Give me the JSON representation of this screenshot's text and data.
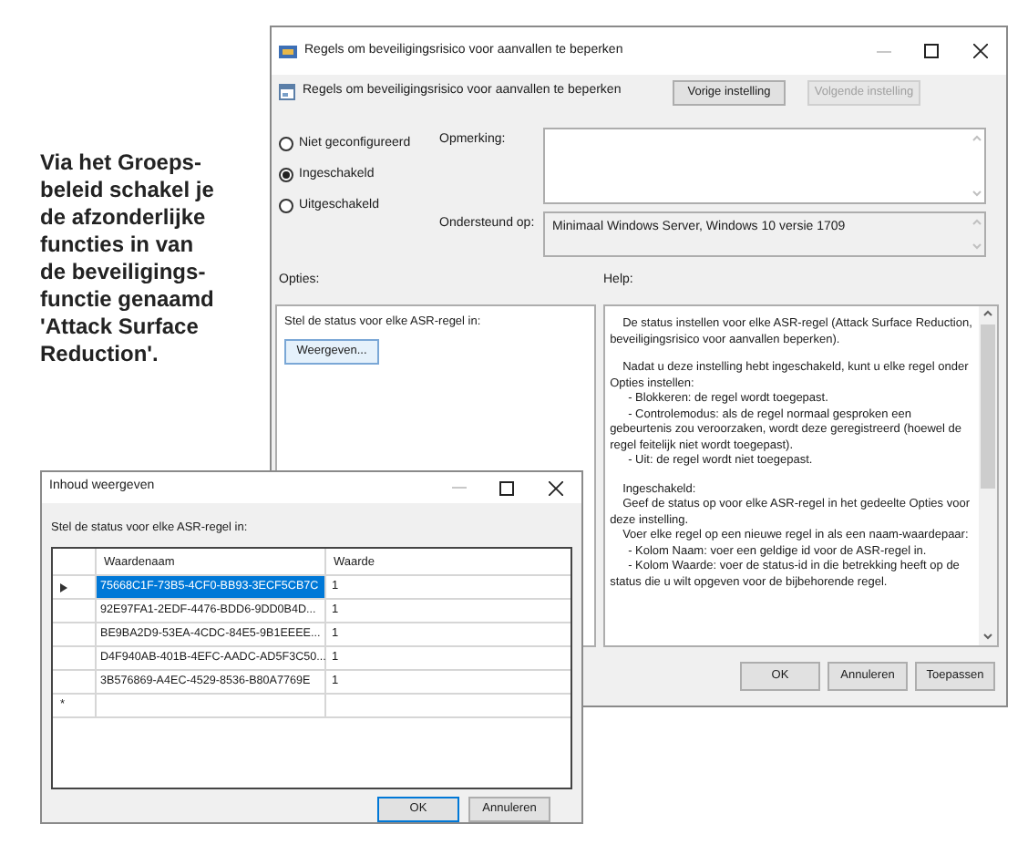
{
  "caption": {
    "lines": [
      "Via het Groeps-",
      "beleid schakel je",
      "de afzonderlijke",
      "functies in van",
      "de beveiligings-",
      "functie genaamd",
      "'Attack Surface",
      "Reduction'."
    ]
  },
  "main_window": {
    "title": "Regels om beveiligingsrisico voor aanvallen te beperken",
    "setting_name": "Regels om beveiligingsrisico voor aanvallen te beperken",
    "nav_buttons": [
      {
        "label": "Vorige instelling",
        "disabled": false
      },
      {
        "label": "Volgende instelling",
        "disabled": true
      }
    ],
    "radios": [
      {
        "label": "Niet geconfigureerd",
        "selected": false
      },
      {
        "label": "Ingeschakeld",
        "selected": true
      },
      {
        "label": "Uitgeschakeld",
        "selected": false
      }
    ],
    "comment_label": "Opmerking:",
    "supported_label": "Ondersteund op:",
    "supported_value": "Minimaal Windows Server, Windows 10 versie 1709",
    "options_label": "Opties:",
    "help_label": "Help:",
    "options": {
      "text": "Stel de status voor elke ASR-regel in:",
      "button": "Weergeven..."
    },
    "help": [
      [
        {
          "kind": "para",
          "text": "De status instellen voor elke ASR-regel (Attack Surface Reduction, beveiligingsrisico voor aanvallen beperken)."
        }
      ],
      [
        {
          "kind": "para",
          "text": "Nadat u deze instelling hebt ingeschakeld, kunt u elke regel onder Opties instellen:"
        },
        {
          "kind": "item",
          "text": "- Blokkeren: de regel wordt toegepast."
        },
        {
          "kind": "item",
          "text": "- Controlemodus: als de regel normaal gesproken een gebeurtenis zou veroorzaken, wordt deze geregistreerd (hoewel de regel feitelijk niet wordt toegepast)."
        },
        {
          "kind": "item",
          "text": "- Uit: de regel wordt niet toegepast."
        }
      ],
      [
        {
          "kind": "para",
          "text": "Ingeschakeld:"
        },
        {
          "kind": "para",
          "text": "Geef de status op voor elke ASR-regel in het gedeelte Opties voor deze instelling."
        },
        {
          "kind": "para",
          "text": "Voer elke regel op een nieuwe regel in als een naam-waardepaar:"
        },
        {
          "kind": "item",
          "text": "- Kolom Naam: voer een geldige id voor de ASR-regel in."
        },
        {
          "kind": "item",
          "text": "- Kolom Waarde: voer de status-id in die betrekking heeft op de status die u wilt opgeven voor de bijbehorende regel."
        }
      ]
    ],
    "buttons": [
      "OK",
      "Annuleren",
      "Toepassen"
    ]
  },
  "content_window": {
    "title": "Inhoud weergeven",
    "label": "Stel de status voor elke ASR-regel in:",
    "columns": [
      "Waardenaam",
      "Waarde"
    ],
    "rows": [
      {
        "name": "75668C1F-73B5-4CF0-BB93-3ECF5CB7C",
        "value": "1",
        "selected": true
      },
      {
        "name": "92E97FA1-2EDF-4476-BDD6-9DD0B4D...",
        "value": "1",
        "selected": false
      },
      {
        "name": "BE9BA2D9-53EA-4CDC-84E5-9B1EEEE...",
        "value": "1",
        "selected": false
      },
      {
        "name": "D4F940AB-401B-4EFC-AADC-AD5F3C50...",
        "value": "1",
        "selected": false
      },
      {
        "name": "3B576869-A4EC-4529-8536-B80A7769E",
        "value": "1",
        "selected": false
      }
    ],
    "new_row_marker": "*",
    "buttons": [
      "OK",
      "Annuleren"
    ]
  }
}
